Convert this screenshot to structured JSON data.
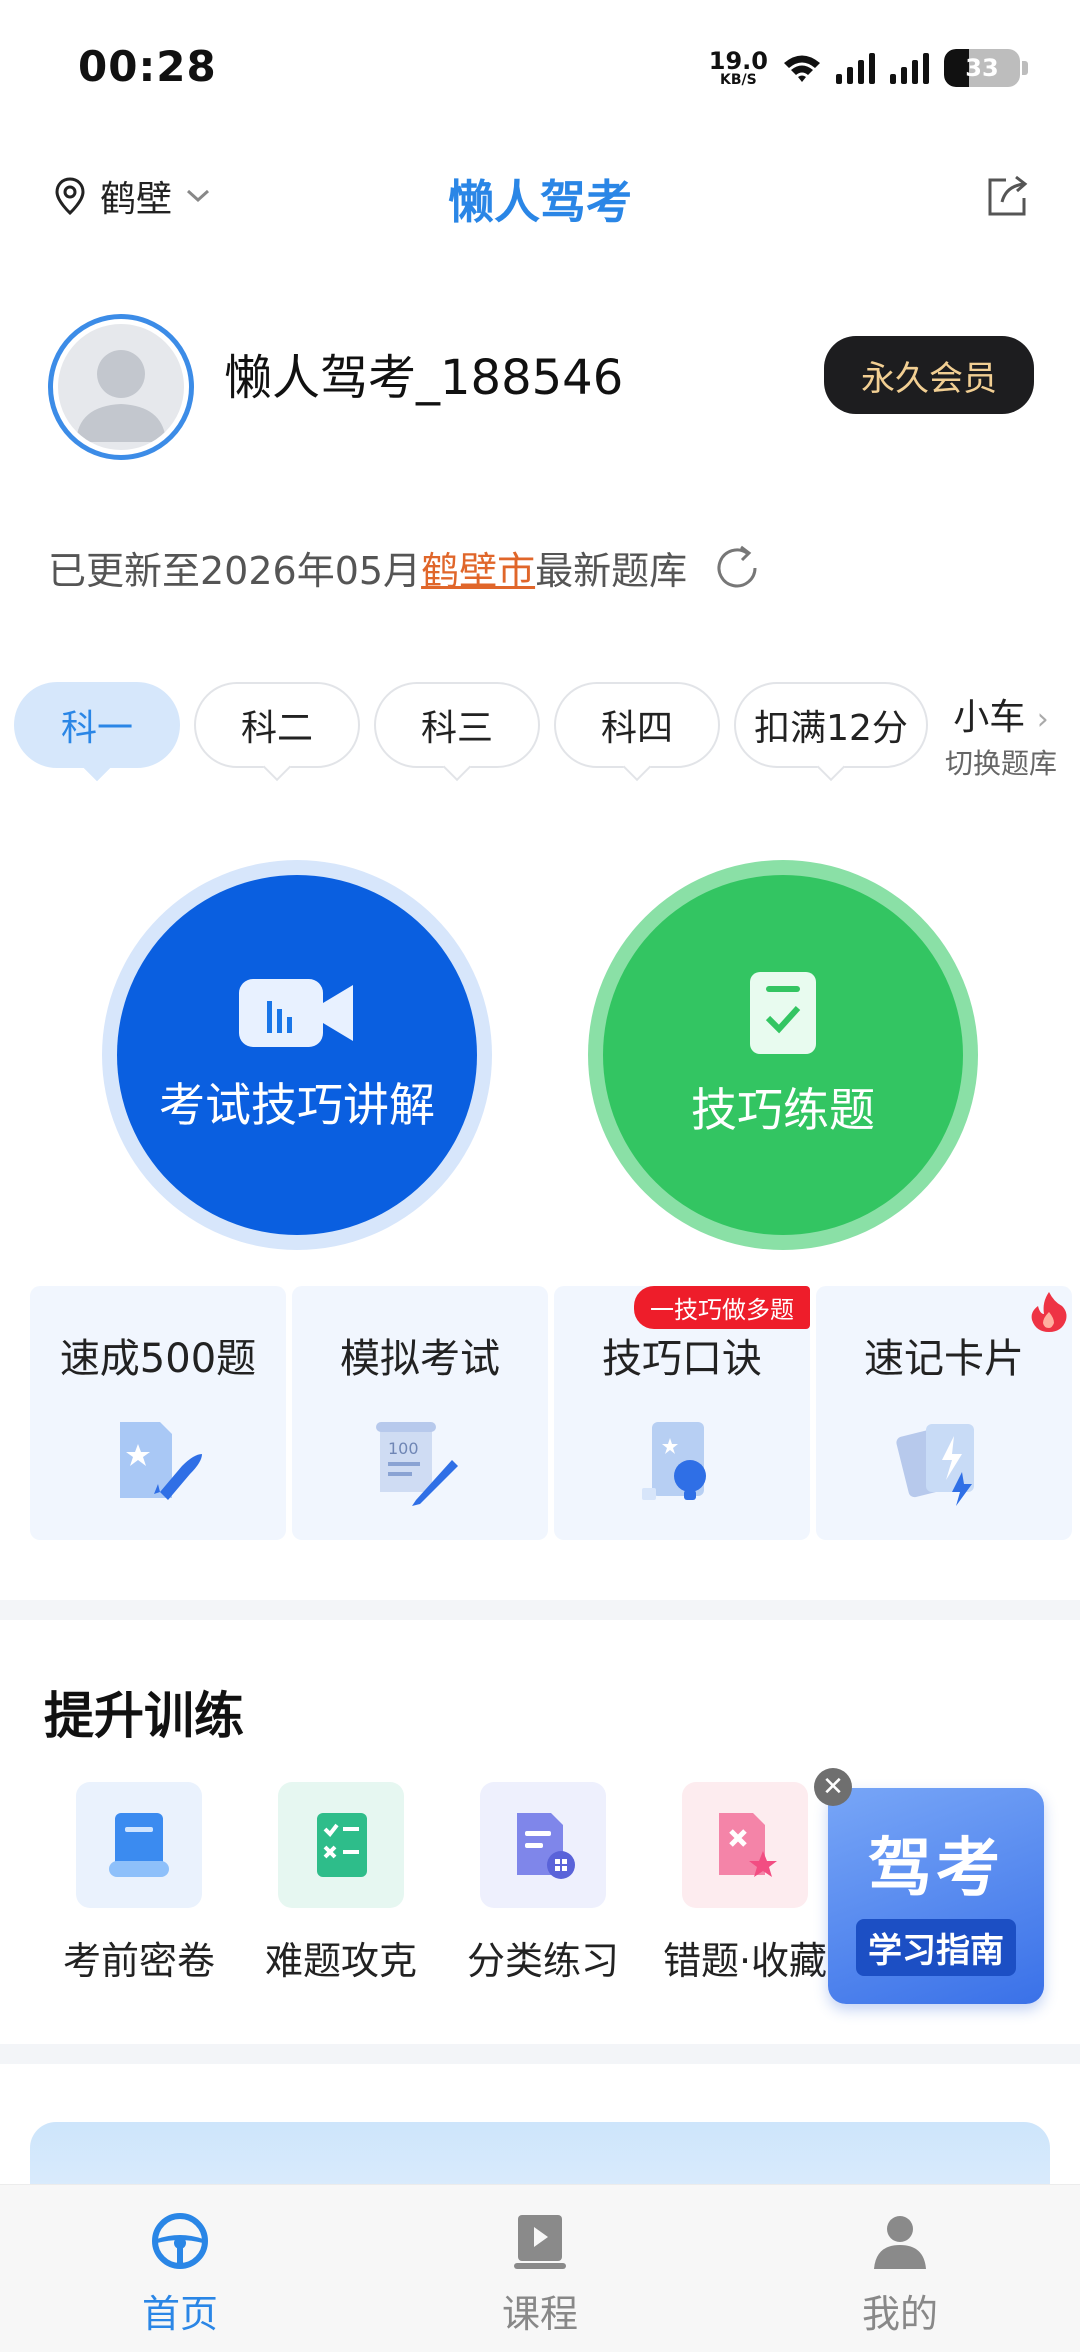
{
  "status_bar": {
    "time": "00:28",
    "net_speed_value": "19.0",
    "net_speed_unit": "KB/S",
    "battery": "33",
    "battery_level": 0.33
  },
  "header": {
    "location": "鹤壁",
    "app_title": "懒人驾考",
    "share_icon": "share-icon"
  },
  "profile": {
    "username": "懒人驾考_188546",
    "vip_label": "永久会员"
  },
  "update": {
    "prefix": "已更新至2026年05月",
    "city": "鹤壁市",
    "suffix": "最新题库"
  },
  "tabs": [
    {
      "label": "科一",
      "active": true
    },
    {
      "label": "科二",
      "active": false
    },
    {
      "label": "科三",
      "active": false
    },
    {
      "label": "科四",
      "active": false
    },
    {
      "label": "扣满12分",
      "active": false
    }
  ],
  "car_switch": {
    "vehicle": "小车",
    "hint": "切换题库"
  },
  "main_actions": {
    "video": {
      "label": "考试技巧讲解",
      "color": "#0a5fe0"
    },
    "practice": {
      "label": "技巧练题",
      "color": "#33c562"
    }
  },
  "feature_cards": [
    {
      "title": "速成500题",
      "icon": "rocket-doc-icon"
    },
    {
      "title": "模拟考试",
      "icon": "exam-paper-icon"
    },
    {
      "title": "技巧口诀",
      "icon": "lightbulb-card-icon",
      "badge": "一技巧做多题"
    },
    {
      "title": "速记卡片",
      "icon": "flash-cards-icon",
      "hot": "fire-icon"
    }
  ],
  "training": {
    "title": "提升训练",
    "items": [
      {
        "label": "考前密卷",
        "icon": "scroll-icon"
      },
      {
        "label": "难题攻克",
        "icon": "checklist-icon"
      },
      {
        "label": "分类练习",
        "icon": "category-doc-icon"
      },
      {
        "label": "错题·收藏",
        "icon": "wrong-star-icon"
      }
    ],
    "guide": {
      "big": "驾考",
      "small": "学习指南"
    }
  },
  "bottom_nav": [
    {
      "label": "首页",
      "icon": "steering-wheel-icon",
      "active": true
    },
    {
      "label": "课程",
      "icon": "course-book-icon",
      "active": false
    },
    {
      "label": "我的",
      "icon": "person-icon",
      "active": false
    }
  ],
  "colors": {
    "accent": "#2a86e6",
    "video": "#0a5fe0",
    "practice": "#33c562",
    "badge": "#ee1d2a",
    "city_link": "#e0662a"
  }
}
